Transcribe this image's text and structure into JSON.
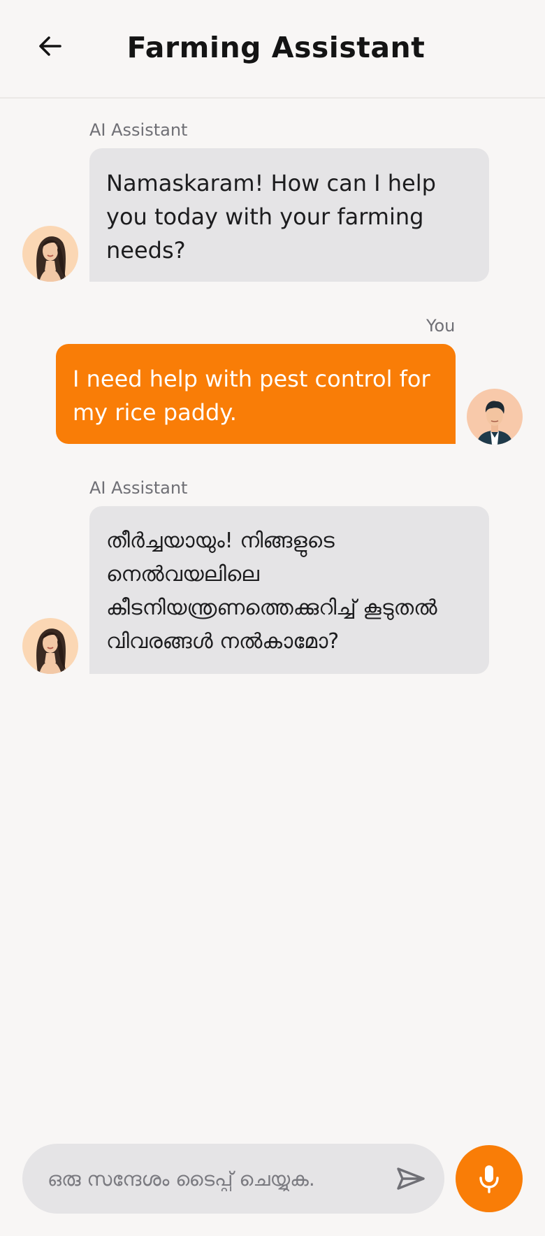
{
  "header": {
    "title": "Farming Assistant",
    "back_icon": "arrow-left-icon"
  },
  "messages": [
    {
      "sender": "AI Assistant",
      "role": "assistant",
      "text": "Namaskaram! How can I help you today with your farming needs?"
    },
    {
      "sender": "You",
      "role": "user",
      "text": "I need help with pest control for my rice paddy."
    },
    {
      "sender": "AI Assistant",
      "role": "assistant",
      "text": "തീർച്ചയായും! നിങ്ങളുടെ നെൽവയലിലെ കീടനിയന്ത്രണത്തെക്കുറിച്ച് കൂടുതൽ വിവരങ്ങൾ നൽകാമോ?"
    }
  ],
  "composer": {
    "placeholder": "ഒരു സന്ദേശം ടൈപ്പ് ചെയ്യുക.",
    "value": "",
    "send_icon": "send-icon",
    "mic_icon": "microphone-icon"
  },
  "colors": {
    "accent": "#f97d07",
    "ai_bubble": "#e5e4e6",
    "background": "#f8f6f5"
  }
}
